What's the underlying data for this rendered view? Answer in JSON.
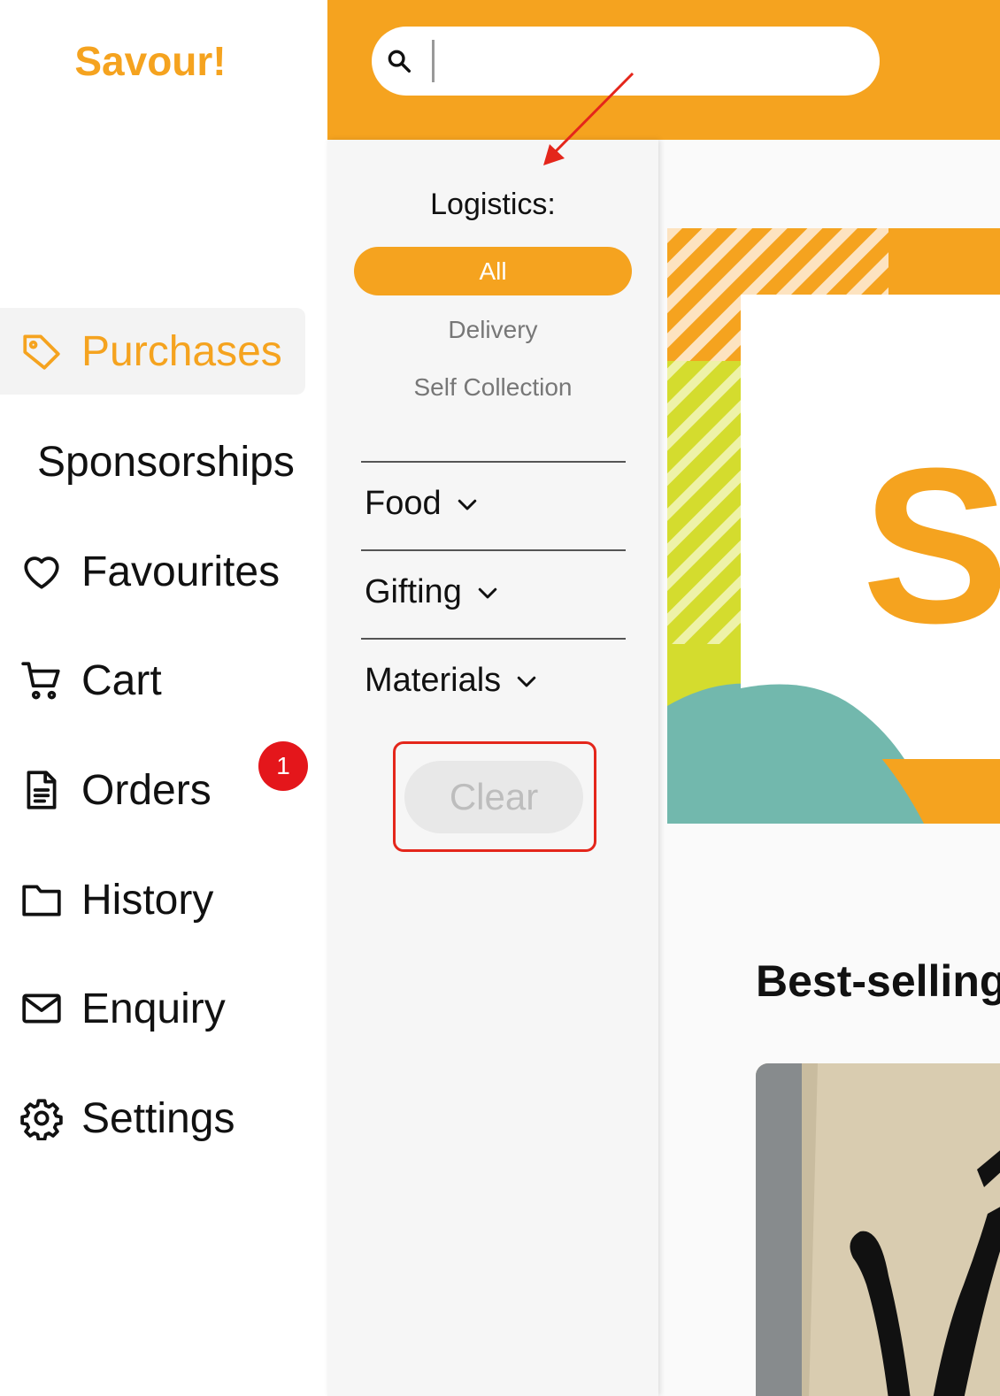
{
  "app": {
    "brand": "Savour!"
  },
  "sidebar": {
    "items": [
      {
        "label": "Purchases",
        "icon": "tag-icon",
        "active": true
      },
      {
        "label": "Sponsorships",
        "icon": "",
        "active": false
      },
      {
        "label": "Favourites",
        "icon": "heart-icon",
        "active": false
      },
      {
        "label": "Cart",
        "icon": "cart-icon",
        "active": false
      },
      {
        "label": "Orders",
        "icon": "document-icon",
        "active": false,
        "badge": "1"
      },
      {
        "label": "History",
        "icon": "folder-icon",
        "active": false
      },
      {
        "label": "Enquiry",
        "icon": "mail-icon",
        "active": false
      },
      {
        "label": "Settings",
        "icon": "gear-icon",
        "active": false
      }
    ]
  },
  "header": {
    "search": {
      "value": "",
      "placeholder": "",
      "icon": "search-icon"
    }
  },
  "filter": {
    "logistics_title": "Logistics:",
    "logistics_options": [
      "All",
      "Delivery",
      "Self Collection"
    ],
    "selected_option": "All",
    "categories": [
      "Food",
      "Gifting",
      "Materials"
    ],
    "clear_label": "Clear"
  },
  "main": {
    "banner_text": "SA",
    "section_title": "Best-selling"
  },
  "colors": {
    "accent": "#f5a31f",
    "badge": "#e4161b",
    "annotation": "#e4261b",
    "banner_green": "#d4dc2e",
    "banner_teal": "#72b8ad"
  }
}
